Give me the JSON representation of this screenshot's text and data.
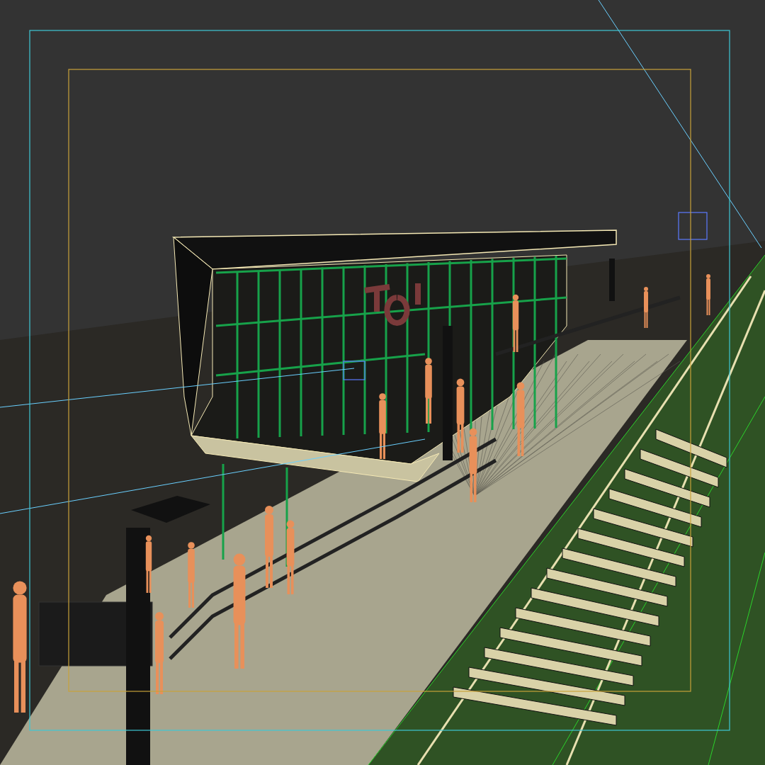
{
  "viewport": {
    "safe_frames_shown": true
  }
}
